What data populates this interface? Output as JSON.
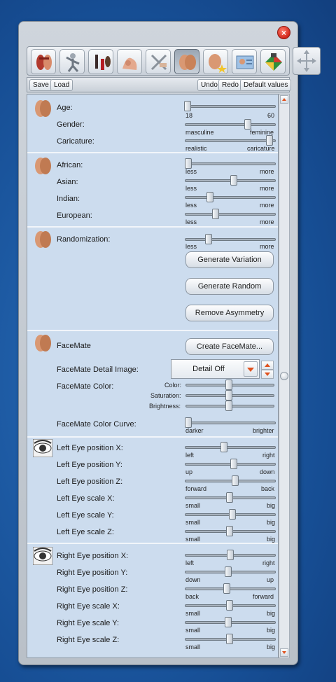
{
  "window": {
    "close_label": "×"
  },
  "toolbar": {
    "icons": [
      "anatomy-icon",
      "pose-icon",
      "cosmetics-icon",
      "body-morph-icon",
      "hair-tools-icon",
      "face-icon",
      "face-star-icon",
      "id-card-icon",
      "color-picker-icon"
    ],
    "active_index": 5,
    "side_icon": "move-arrows-icon"
  },
  "actions": {
    "save": "Save",
    "load": "Load",
    "undo": "Undo",
    "redo": "Redo",
    "default": "Default values"
  },
  "sections": {
    "age": {
      "age_label": "Age:",
      "age_min": "18",
      "age_max": "60",
      "age_value": 0.03,
      "gender_label": "Gender:",
      "gender_min": "masculine",
      "gender_max": "feminine",
      "gender_value": 0.69,
      "caricature_label": "Caricature:",
      "caricature_min": "realistic",
      "caricature_max": "caricature",
      "caricature_value": 0.93
    },
    "ethnicity": {
      "african_label": "African:",
      "african_value": 0.04,
      "asian_label": "Asian:",
      "asian_value": 0.54,
      "indian_label": "Indian:",
      "indian_value": 0.28,
      "european_label": "European:",
      "european_value": 0.34,
      "less": "less",
      "more": "more"
    },
    "randomization": {
      "label": "Randomization:",
      "value": 0.26,
      "less": "less",
      "more": "more",
      "generate_variation": "Generate Variation",
      "generate_random": "Generate Random",
      "remove_asymmetry": "Remove Asymmetry"
    },
    "facemate": {
      "label": "FaceMate",
      "create_button": "Create FaceMate...",
      "detail_label": "FaceMate Detail Image:",
      "detail_value": "Detail Off",
      "color_label": "FaceMate Color:",
      "color_sub": "Color:",
      "saturation_sub": "Saturation:",
      "brightness_sub": "Brightness:",
      "color_value": 0.49,
      "saturation_value": 0.49,
      "brightness_value": 0.49,
      "curve_label": "FaceMate Color Curve:",
      "curve_min": "darker",
      "curve_max": "brighter",
      "curve_value": 0.04
    },
    "left_eye": {
      "pos_x_label": "Left Eye position X:",
      "pos_x_min": "left",
      "pos_x_max": "right",
      "pos_x_value": 0.43,
      "pos_y_label": "Left Eye position Y:",
      "pos_y_min": "up",
      "pos_y_max": "down",
      "pos_y_value": 0.54,
      "pos_z_label": "Left Eye position Z:",
      "pos_z_min": "forward",
      "pos_z_max": "back",
      "pos_z_value": 0.55,
      "scale_x_label": "Left Eye scale X:",
      "scale_x_value": 0.49,
      "scale_y_label": "Left Eye scale Y:",
      "scale_y_value": 0.52,
      "scale_z_label": "Left Eye scale Z:",
      "scale_z_value": 0.49,
      "small": "small",
      "big": "big"
    },
    "right_eye": {
      "pos_x_label": "Right Eye position X:",
      "pos_x_min": "left",
      "pos_x_max": "right",
      "pos_x_value": 0.5,
      "pos_y_label": "Right Eye position Y:",
      "pos_y_min": "down",
      "pos_y_max": "up",
      "pos_y_value": 0.48,
      "pos_z_label": "Right Eye position Z:",
      "pos_z_min": "back",
      "pos_z_max": "forward",
      "pos_z_value": 0.46,
      "scale_x_label": "Right Eye scale X:",
      "scale_x_value": 0.49,
      "scale_y_label": "Right Eye scale Y:",
      "scale_y_value": 0.48,
      "scale_z_label": "Right Eye scale Z:",
      "scale_z_value": 0.49,
      "small": "small",
      "big": "big"
    }
  }
}
